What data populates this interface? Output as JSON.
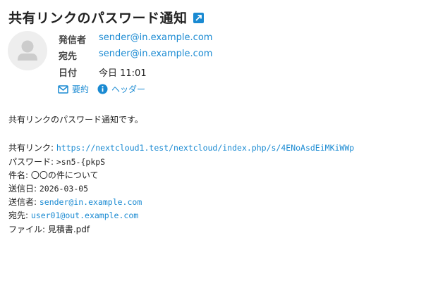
{
  "message": {
    "subject": "共有リンクのパスワード通知",
    "popout_icon": "external-link-icon"
  },
  "header": {
    "from_label": "発信者",
    "from_value": "sender@in.example.com",
    "to_label": "宛先",
    "to_value": "sender@in.example.com",
    "date_label": "日付",
    "date_value": "今日 11:01",
    "summary_link": "要約",
    "headers_link": "ヘッダー"
  },
  "body": {
    "intro": "共有リンクのパスワード通知です。",
    "lines": [
      {
        "label": "共有リンク: ",
        "value": "https://nextcloud1.test/nextcloud/index.php/s/4ENoAsdEiMKiWWp"
      },
      {
        "label": "パスワード: ",
        "value": ">sn5-{pkpS"
      },
      {
        "label": "件名: ",
        "value": "〇〇の件について"
      },
      {
        "label": "送信日: ",
        "value": "2026-03-05"
      },
      {
        "label": "送信者: ",
        "value": "sender@in.example.com"
      },
      {
        "label": "宛先: ",
        "value": "user01@out.example.com"
      },
      {
        "label": "ファイル: ",
        "value": "見積書.pdf"
      }
    ]
  },
  "colors": {
    "accent": "#1a8ad2",
    "text": "#222222",
    "avatar_bg": "#eeeeee"
  }
}
